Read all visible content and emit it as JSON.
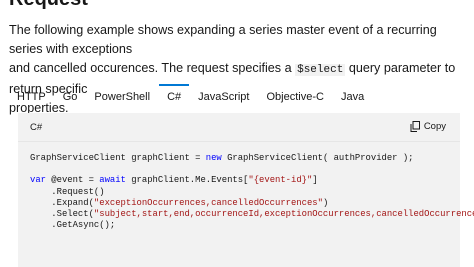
{
  "section": {
    "heading": "Request",
    "description_line1": "The following example shows expanding a series master event of a recurring series with exceptions",
    "description_line2_before": "and cancelled occurences. The request specifies a ",
    "inline_code": "$select",
    "description_line2_after": " query parameter to return specific",
    "description_line3": "properties."
  },
  "tabs": [
    {
      "label": "HTTP"
    },
    {
      "label": "Go"
    },
    {
      "label": "PowerShell"
    },
    {
      "label": "C#",
      "active": true
    },
    {
      "label": "JavaScript"
    },
    {
      "label": "Objective-C"
    },
    {
      "label": "Java"
    }
  ],
  "code_panel": {
    "language": "C#",
    "copy_label": "Copy",
    "lines": {
      "l1_a": "GraphServiceClient graphClient = ",
      "l1_new": "new",
      "l1_b": " GraphServiceClient( authProvider );",
      "l2_var": "var",
      "l2_a": " @event = ",
      "l2_await": "await",
      "l2_b": " graphClient.Me.Events[",
      "l2_str": "\"{event-id}\"",
      "l2_c": "]",
      "l3": "    .Request()",
      "l4_a": "    .Expand(",
      "l4_str": "\"exceptionOccurrences,cancelledOccurrences\"",
      "l4_b": ")",
      "l5_a": "    .Select(",
      "l5_str": "\"subject,start,end,occurrenceId,exceptionOccurrences,cancelledOccurrences\"",
      "l5_b": ")",
      "l6": "    .GetAsync();"
    }
  },
  "colors": {
    "accent": "#0078d4",
    "code_background": "#f2f2f2",
    "keyword": "#0101fd",
    "string": "#a31515"
  },
  "icons": {
    "copy": "copy-icon"
  }
}
